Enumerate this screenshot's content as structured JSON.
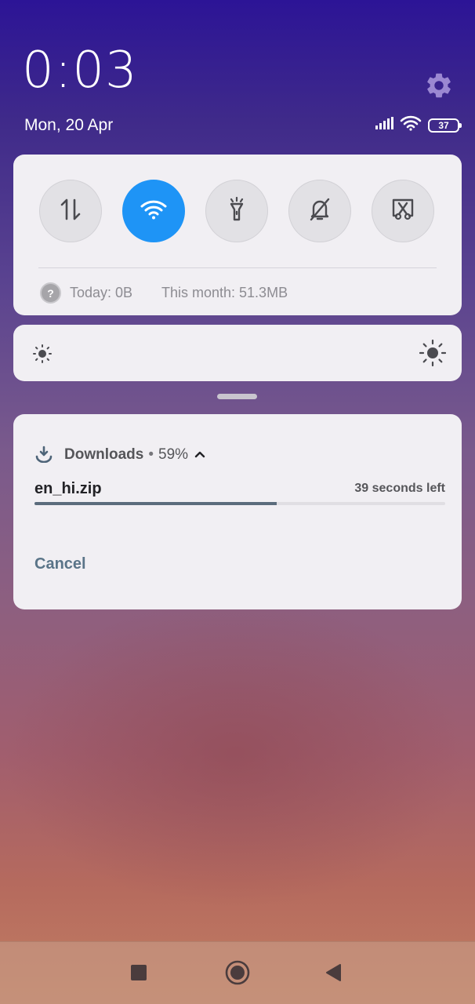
{
  "status": {
    "time": "0:03",
    "date": "Mon, 20 Apr",
    "battery": "37"
  },
  "icons": {
    "settings": "gear-icon",
    "signal": "signal-icon",
    "wifi_status": "wifi-icon",
    "battery": "battery-icon"
  },
  "quick_settings": {
    "toggles": [
      {
        "name": "mobile-data",
        "icon": "data-transfer-icon",
        "active": false
      },
      {
        "name": "wifi",
        "icon": "wifi-icon",
        "active": true
      },
      {
        "name": "flashlight",
        "icon": "flashlight-icon",
        "active": false
      },
      {
        "name": "silent",
        "icon": "bell-off-icon",
        "active": false
      },
      {
        "name": "screenshot",
        "icon": "screenshot-icon",
        "active": false
      }
    ],
    "usage_today": "Today: 0B",
    "usage_month": "This month: 51.3MB"
  },
  "notification": {
    "app_name": "Downloads",
    "separator": "•",
    "percent": "59%",
    "file_name": "en_hi.zip",
    "time_left": "39 seconds left",
    "progress": 0.59,
    "action_cancel": "Cancel"
  },
  "colors": {
    "accent_active": "#1e94f6",
    "progress": "#5b6c7c",
    "action_text": "#5a7488"
  }
}
